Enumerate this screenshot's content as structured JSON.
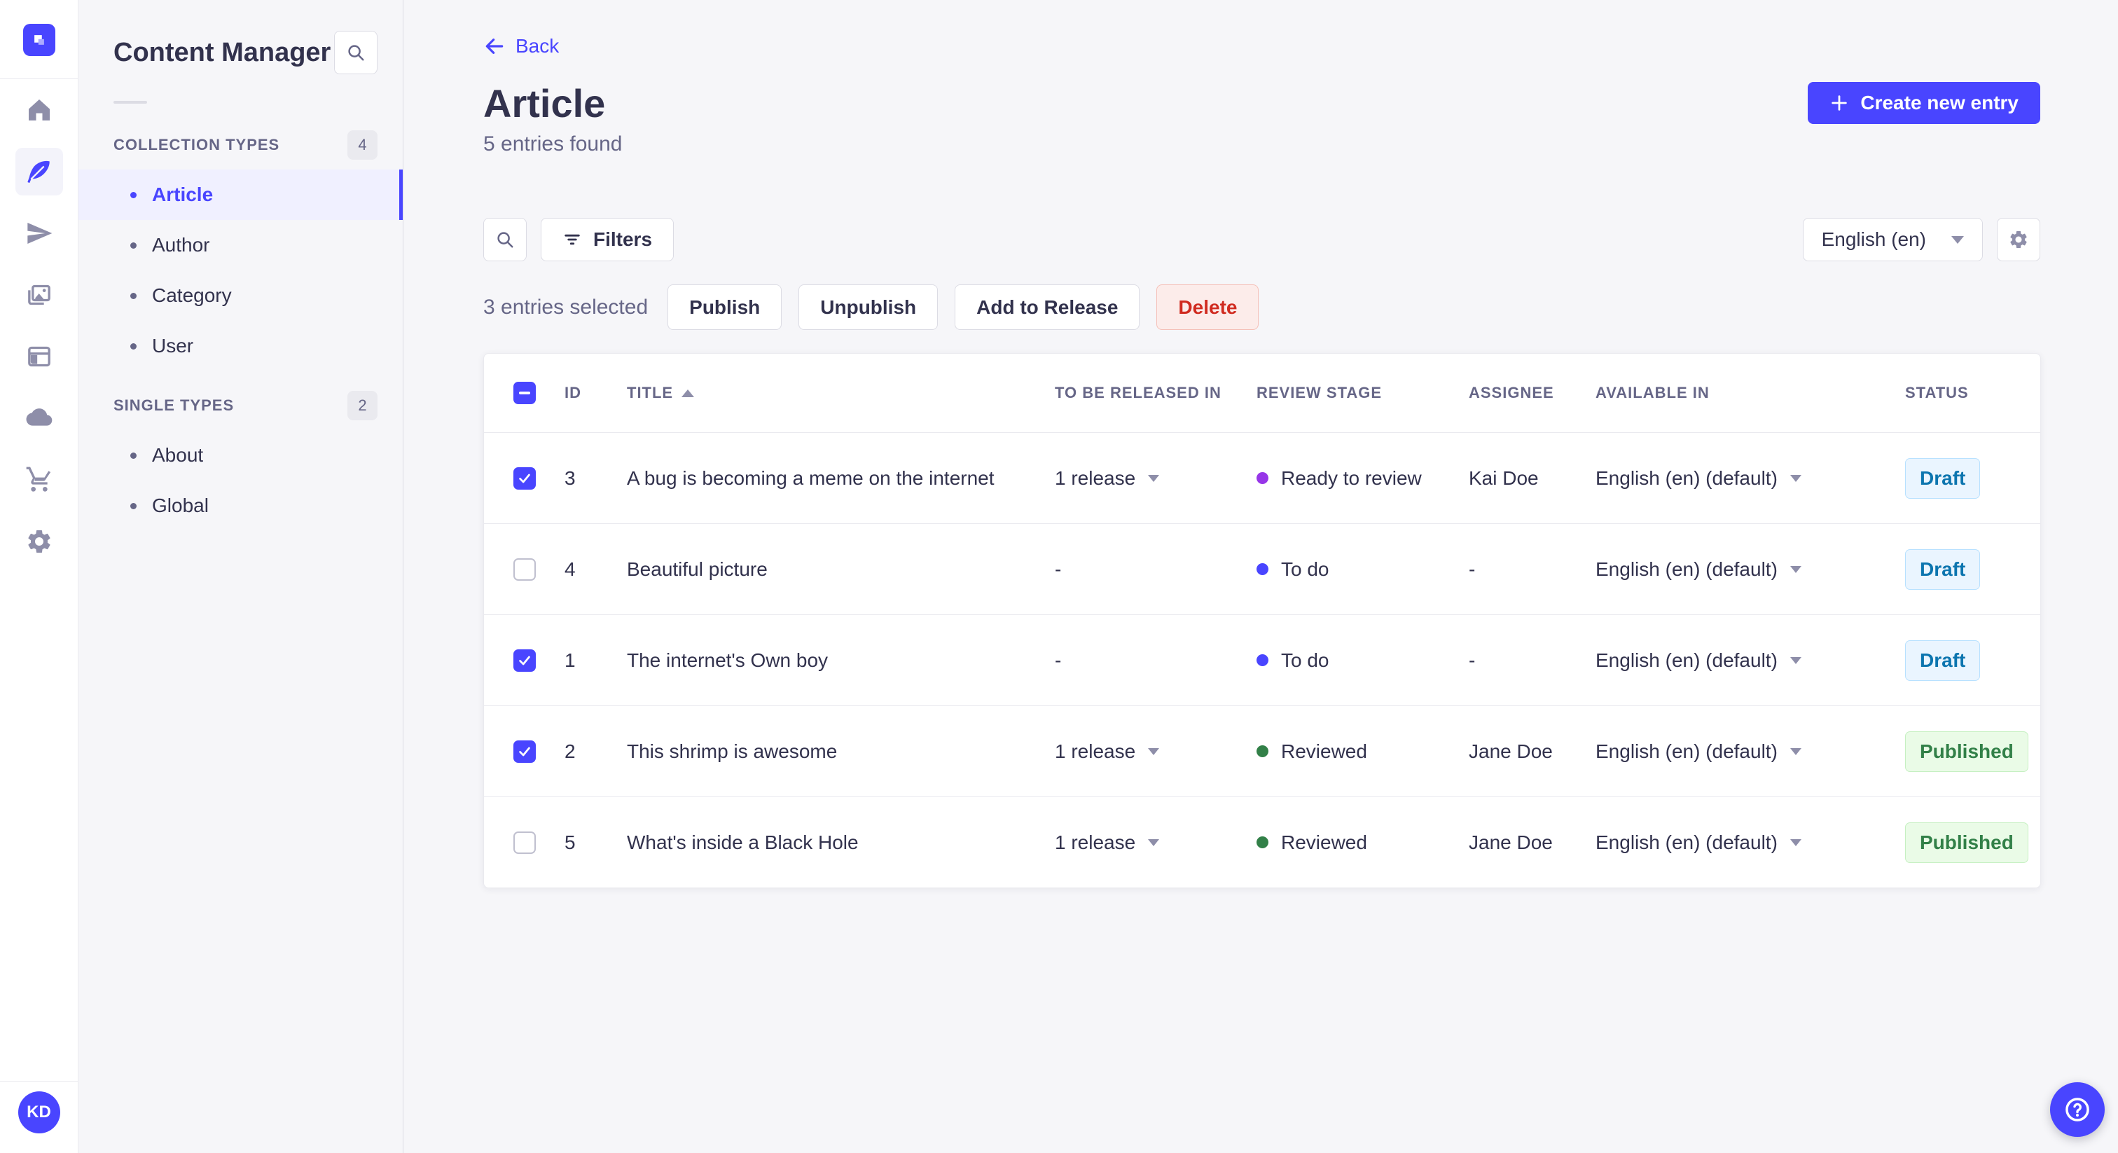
{
  "colors": {
    "primary": "#4945ff",
    "primary_light": "#f0f0ff",
    "draft_text": "#0c75af",
    "draft_bg": "#eaf5ff",
    "published_text": "#328048",
    "published_bg": "#eafbe7",
    "danger_text": "#d02b20",
    "danger_bg": "#fcecea",
    "stage_ready_to_review": "#9736e8",
    "stage_to_do": "#4945ff",
    "stage_reviewed": "#328048"
  },
  "nav": {
    "icons": [
      "strapi-logo",
      "home",
      "feather",
      "paper-plane",
      "images",
      "layout",
      "cloud",
      "cart",
      "gear"
    ],
    "active_icon": "feather",
    "avatar_initials": "KD"
  },
  "subnav": {
    "title": "Content Manager",
    "sections": [
      {
        "label": "COLLECTION TYPES",
        "count": "4",
        "items": [
          {
            "label": "Article",
            "active": true
          },
          {
            "label": "Author"
          },
          {
            "label": "Category"
          },
          {
            "label": "User"
          }
        ]
      },
      {
        "label": "SINGLE TYPES",
        "count": "2",
        "items": [
          {
            "label": "About"
          },
          {
            "label": "Global"
          }
        ]
      }
    ]
  },
  "header": {
    "back_label": "Back",
    "title": "Article",
    "subtitle": "5 entries found",
    "create_label": "Create new entry"
  },
  "toolbar": {
    "filters_label": "Filters",
    "locale_value": "English (en)"
  },
  "selection": {
    "text": "3 entries selected",
    "publish_label": "Publish",
    "unpublish_label": "Unpublish",
    "add_to_release_label": "Add to Release",
    "delete_label": "Delete"
  },
  "table": {
    "headers": {
      "id": "ID",
      "title": "TITLE",
      "released": "TO BE RELEASED IN",
      "stage": "REVIEW STAGE",
      "assignee": "ASSIGNEE",
      "available": "AVAILABLE IN",
      "status": "STATUS"
    },
    "sort": {
      "column": "TITLE",
      "direction": "asc"
    },
    "rows": [
      {
        "selected": true,
        "id": "3",
        "title": "A bug is becoming a meme on the internet",
        "released": "1 release",
        "stage": "Ready to review",
        "stage_color": "#9736e8",
        "assignee": "Kai Doe",
        "available": "English (en) (default)",
        "status": "Draft",
        "status_variant": "draft"
      },
      {
        "selected": false,
        "id": "4",
        "title": "Beautiful picture",
        "released": "-",
        "stage": "To do",
        "stage_color": "#4945ff",
        "assignee": "-",
        "available": "English (en) (default)",
        "status": "Draft",
        "status_variant": "draft"
      },
      {
        "selected": true,
        "id": "1",
        "title": "The internet's Own boy",
        "released": "-",
        "stage": "To do",
        "stage_color": "#4945ff",
        "assignee": "-",
        "available": "English (en) (default)",
        "status": "Draft",
        "status_variant": "draft"
      },
      {
        "selected": true,
        "id": "2",
        "title": "This shrimp is awesome",
        "released": "1 release",
        "stage": "Reviewed",
        "stage_color": "#328048",
        "assignee": "Jane Doe",
        "available": "English (en) (default)",
        "status": "Published",
        "status_variant": "published"
      },
      {
        "selected": false,
        "id": "5",
        "title": "What's inside a Black Hole",
        "released": "1 release",
        "stage": "Reviewed",
        "stage_color": "#328048",
        "assignee": "Jane Doe",
        "available": "English (en) (default)",
        "status": "Published",
        "status_variant": "published"
      }
    ]
  }
}
